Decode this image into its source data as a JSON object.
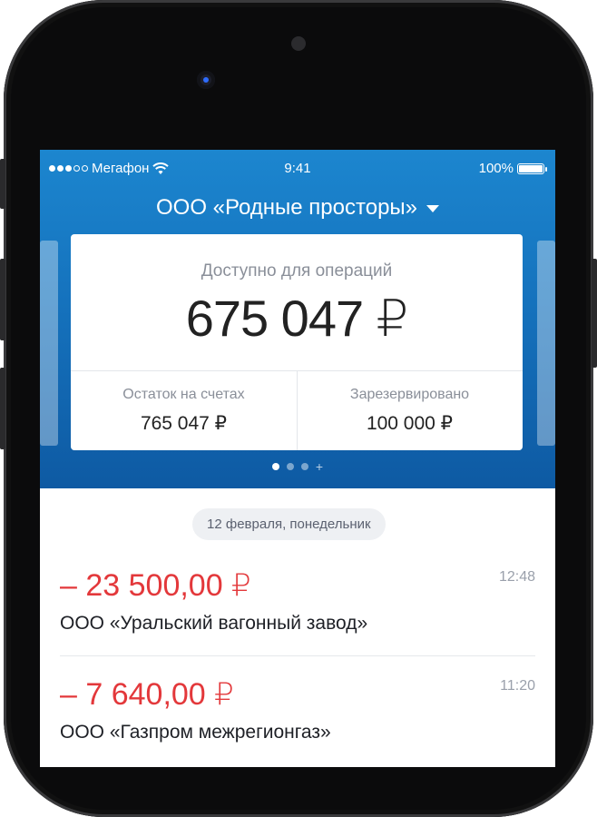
{
  "status_bar": {
    "carrier": "Мегафон",
    "time": "9:41",
    "battery": "100%"
  },
  "header": {
    "organization": "ООО «Родные просторы»"
  },
  "balance_card": {
    "available_label": "Доступно для операций",
    "available_amount": "675 047 ₽",
    "accounts_label": "Остаток на счетах",
    "accounts_amount": "765 047 ₽",
    "reserved_label": "Зарезервировано",
    "reserved_amount": "100 000 ₽"
  },
  "pager": {
    "pages": 3,
    "active_index": 0,
    "plus": "+"
  },
  "feed": {
    "date_label": "12 февраля, понедельник",
    "transactions": [
      {
        "amount": "– 23 500,00 ₽",
        "time": "12:48",
        "counterparty": "ООО «Уральский вагонный завод»"
      },
      {
        "amount": "– 7 640,00 ₽",
        "time": "11:20",
        "counterparty": "ООО «Газпром межрегионгаз»"
      }
    ]
  },
  "colors": {
    "header_blue": "#1572bd",
    "negative_amount": "#e3383b"
  }
}
